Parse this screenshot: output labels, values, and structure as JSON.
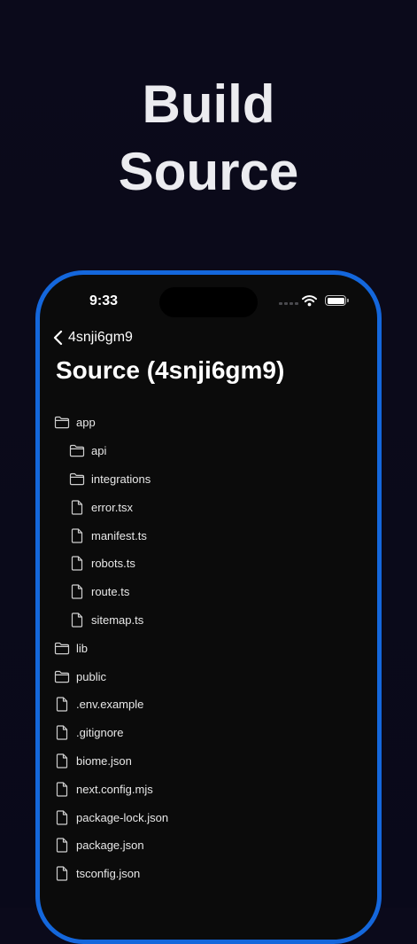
{
  "headline": {
    "line1": "Build",
    "line2": "Source"
  },
  "status_bar": {
    "time": "9:33"
  },
  "nav": {
    "back_label": "4snji6gm9"
  },
  "title": "Source (4snji6gm9)",
  "colors": {
    "frame": "#1467dc",
    "screen": "#0b0b0b",
    "background": "#0b0a1b"
  },
  "tree": [
    {
      "name": "app",
      "type": "folder",
      "depth": 0
    },
    {
      "name": "api",
      "type": "folder",
      "depth": 1
    },
    {
      "name": "integrations",
      "type": "folder",
      "depth": 1
    },
    {
      "name": "error.tsx",
      "type": "file",
      "depth": 1
    },
    {
      "name": "manifest.ts",
      "type": "file",
      "depth": 1
    },
    {
      "name": "robots.ts",
      "type": "file",
      "depth": 1
    },
    {
      "name": "route.ts",
      "type": "file",
      "depth": 1
    },
    {
      "name": "sitemap.ts",
      "type": "file",
      "depth": 1
    },
    {
      "name": "lib",
      "type": "folder",
      "depth": 0
    },
    {
      "name": "public",
      "type": "folder",
      "depth": 0
    },
    {
      "name": ".env.example",
      "type": "file",
      "depth": 0
    },
    {
      "name": ".gitignore",
      "type": "file",
      "depth": 0
    },
    {
      "name": "biome.json",
      "type": "file",
      "depth": 0
    },
    {
      "name": "next.config.mjs",
      "type": "file",
      "depth": 0
    },
    {
      "name": "package-lock.json",
      "type": "file",
      "depth": 0
    },
    {
      "name": "package.json",
      "type": "file",
      "depth": 0
    },
    {
      "name": "tsconfig.json",
      "type": "file",
      "depth": 0
    }
  ]
}
